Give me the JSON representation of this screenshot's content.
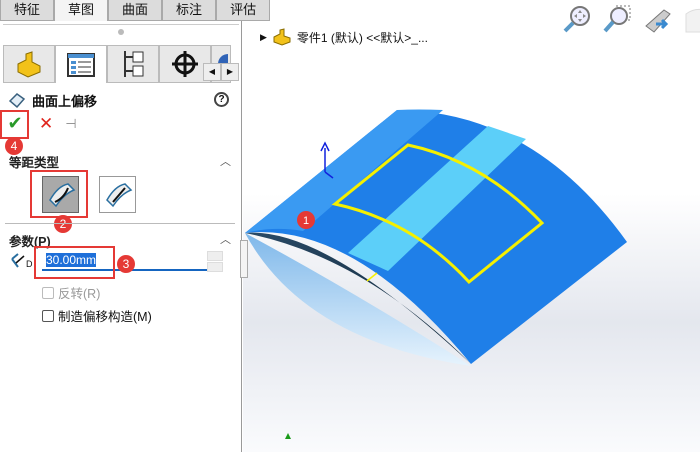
{
  "tabs": [
    "特征",
    "草图",
    "曲面",
    "标注",
    "评估"
  ],
  "active_tab": "草图",
  "panel": {
    "feature_title": "曲面上偏移",
    "help": "?",
    "offset_type_label": "等距类型",
    "params_label": "参数(P)",
    "distance_value": "30.00mm",
    "distance_icon_letter": "D",
    "reverse_label": "反转(R)",
    "construct_label": "制造偏移构造(M)"
  },
  "tree": {
    "part": "零件1 (默认) <<默认>_..."
  },
  "badges": [
    "1",
    "2",
    "3",
    "4"
  ],
  "colors": {
    "surface": "#1f7fe8",
    "sketch": "#f5f000",
    "badge": "#e53935"
  }
}
